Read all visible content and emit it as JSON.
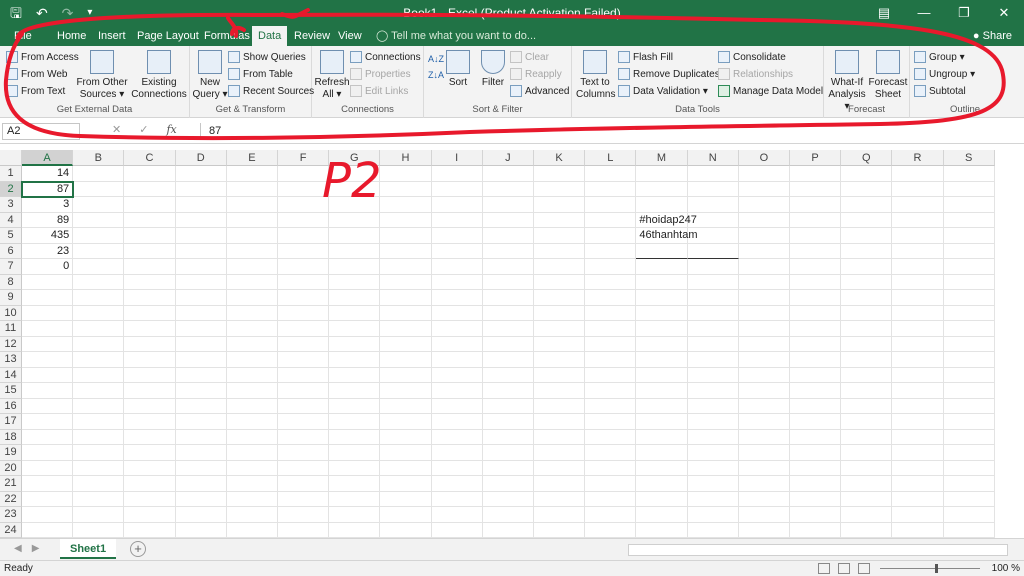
{
  "titlebar": {
    "title": "Book1 - Excel (Product Activation Failed)",
    "save_icon": "save-icon",
    "undo_icon": "undo-icon",
    "redo_icon": "redo-icon"
  },
  "tabs": {
    "file": "File",
    "home": "Home",
    "insert": "Insert",
    "page_layout": "Page Layout",
    "formulas": "Formulas",
    "data": "Data",
    "review": "Review",
    "view": "View",
    "tell_me": "Tell me what you want to do...",
    "share": "Share"
  },
  "ribbon": {
    "get_external": {
      "label": "Get External Data",
      "from_access": "From Access",
      "from_web": "From Web",
      "from_text": "From Text",
      "from_other_1": "From Other",
      "from_other_2": "Sources ▾",
      "existing_1": "Existing",
      "existing_2": "Connections"
    },
    "get_transform": {
      "label": "Get & Transform",
      "new_query_1": "New",
      "new_query_2": "Query ▾",
      "show_queries": "Show Queries",
      "from_table": "From Table",
      "recent_sources": "Recent Sources"
    },
    "connections": {
      "label": "Connections",
      "refresh_1": "Refresh",
      "refresh_2": "All ▾",
      "connections": "Connections",
      "properties": "Properties",
      "edit_links": "Edit Links"
    },
    "sort_filter": {
      "label": "Sort & Filter",
      "sort": "Sort",
      "filter": "Filter",
      "clear": "Clear",
      "reapply": "Reapply",
      "advanced": "Advanced"
    },
    "data_tools": {
      "label": "Data Tools",
      "text_to_1": "Text to",
      "text_to_2": "Columns",
      "flash_fill": "Flash Fill",
      "remove_duplicates": "Remove Duplicates",
      "data_validation": "Data Validation ▾",
      "consolidate": "Consolidate",
      "relationships": "Relationships",
      "manage_model": "Manage Data Model"
    },
    "forecast": {
      "label": "Forecast",
      "whatif_1": "What-If",
      "whatif_2": "Analysis ▾",
      "forecast_1": "Forecast",
      "forecast_2": "Sheet"
    },
    "outline": {
      "label": "Outline",
      "group": "Group ▾",
      "ungroup": "Ungroup ▾",
      "subtotal": "Subtotal"
    }
  },
  "formula_bar": {
    "name_box": "A2",
    "fx": "fx",
    "formula": "87"
  },
  "grid": {
    "columns": [
      "A",
      "B",
      "C",
      "D",
      "E",
      "F",
      "G",
      "H",
      "I",
      "J",
      "K",
      "L",
      "M",
      "N",
      "O",
      "P",
      "Q",
      "R",
      "S"
    ],
    "rows": [
      "1",
      "2",
      "3",
      "4",
      "5",
      "6",
      "7",
      "8",
      "9",
      "10",
      "11",
      "12",
      "13",
      "14",
      "15",
      "16",
      "17",
      "18",
      "19",
      "20",
      "21",
      "22",
      "23",
      "24"
    ],
    "column_a": [
      "14",
      "87",
      "3",
      "89",
      "435",
      "23",
      "0"
    ],
    "m4": "#hoidap247",
    "m5": "46thanhtam"
  },
  "sheets": {
    "active": "Sheet1"
  },
  "status": {
    "ready": "Ready",
    "zoom": "100 %"
  },
  "annotation": {
    "text": "P2",
    "color": "#e8192c"
  }
}
